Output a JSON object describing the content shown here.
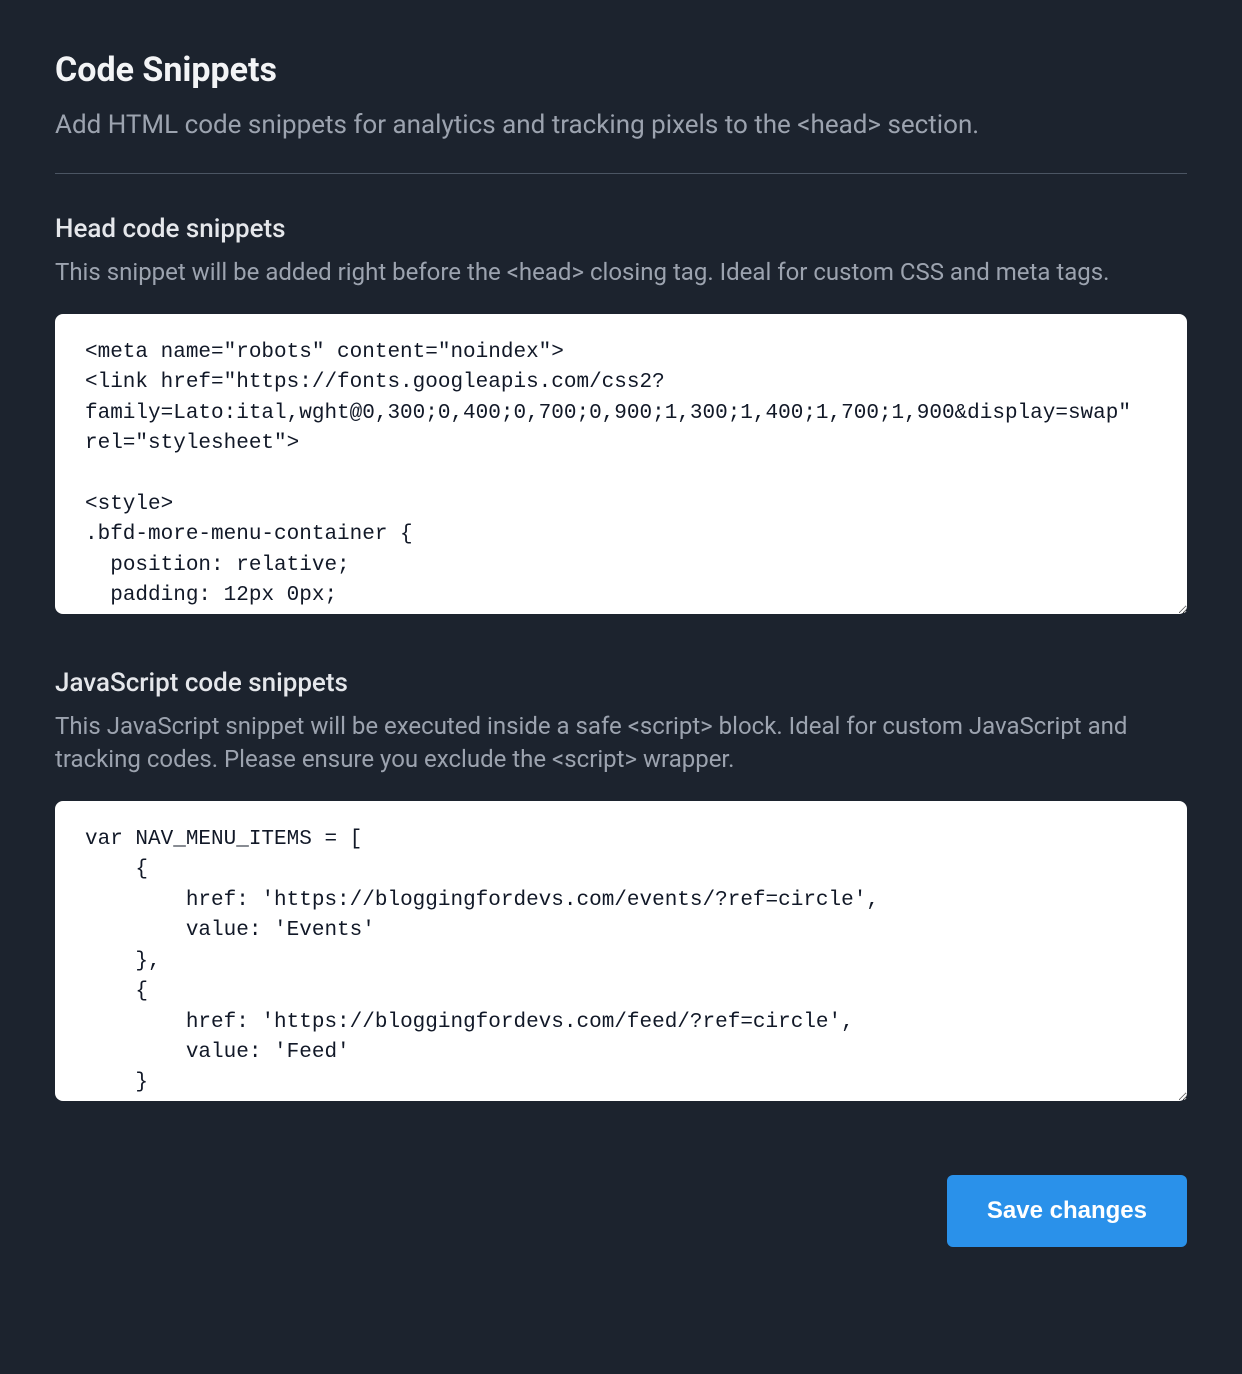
{
  "header": {
    "title": "Code Snippets",
    "subtitle": "Add HTML code snippets for analytics and tracking pixels to the <head> section."
  },
  "sections": {
    "head": {
      "title": "Head code snippets",
      "description": "This snippet will be added right before the <head> closing tag. Ideal for custom CSS and meta tags.",
      "value": "<meta name=\"robots\" content=\"noindex\">\n<link href=\"https://fonts.googleapis.com/css2?family=Lato:ital,wght@0,300;0,400;0,700;0,900;1,300;1,400;1,700;1,900&display=swap\" rel=\"stylesheet\">\n\n<style>\n.bfd-more-menu-container {\n  position: relative;\n  padding: 12px 0px;"
    },
    "js": {
      "title": "JavaScript code snippets",
      "description": "This JavaScript snippet will be executed inside a safe <script> block. Ideal for custom JavaScript and tracking codes. Please ensure you exclude the <script> wrapper.",
      "value": "var NAV_MENU_ITEMS = [\n    {\n        href: 'https://bloggingfordevs.com/events/?ref=circle',\n        value: 'Events'\n    },\n    {\n        href: 'https://bloggingfordevs.com/feed/?ref=circle',\n        value: 'Feed'\n    }"
    }
  },
  "actions": {
    "save_label": "Save changes"
  }
}
